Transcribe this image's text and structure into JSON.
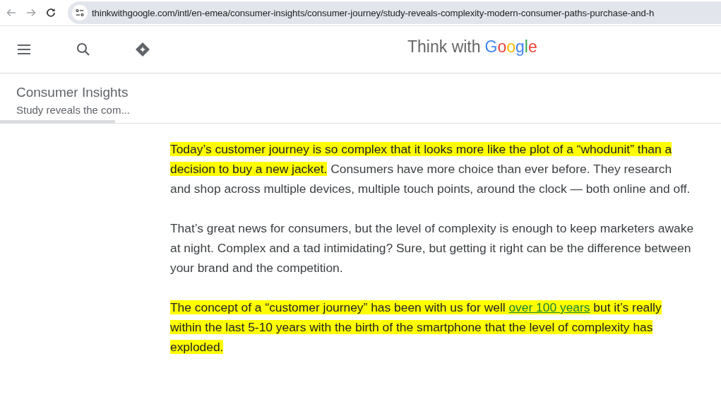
{
  "browser": {
    "url": "thinkwithgoogle.com/intl/en-emea/consumer-insights/consumer-journey/study-reveals-complexity-modern-consumer-paths-purchase-and-h"
  },
  "header": {
    "logo_prefix": "Think with",
    "logo_brand": "Google"
  },
  "breadcrumb": {
    "section": "Consumer Insights",
    "article": "Study reveals the com...",
    "level": 0.16
  },
  "paragraphs": [
    [
      {
        "text": "Today’s customer journey is so complex that it looks more like the plot of a “whodunit” than a decision to buy a new jacket.",
        "highlighted": true,
        "link": false
      },
      {
        "text": " Consumers have more choice than ever before. They research and shop across multiple devices, multiple touch points, around the clock — both online and off.",
        "highlighted": false,
        "link": false
      }
    ],
    [
      {
        "text": "That’s great news for consumers, but the level of complexity is enough to keep marketers awake at night. Complex and a tad intimidating? Sure, but getting it right can be the difference between your brand and the competition.",
        "highlighted": false,
        "link": false
      }
    ],
    [
      {
        "text": "The concept of a “customer journey” has been with us for well ",
        "highlighted": true,
        "link": false
      },
      {
        "text": "over 100 years",
        "highlighted": true,
        "link": true
      },
      {
        "text": " but it’s really within the last 5-10 years with the birth of the smartphone that the level of complexity has exploded.",
        "highlighted": true,
        "link": false
      }
    ]
  ]
}
